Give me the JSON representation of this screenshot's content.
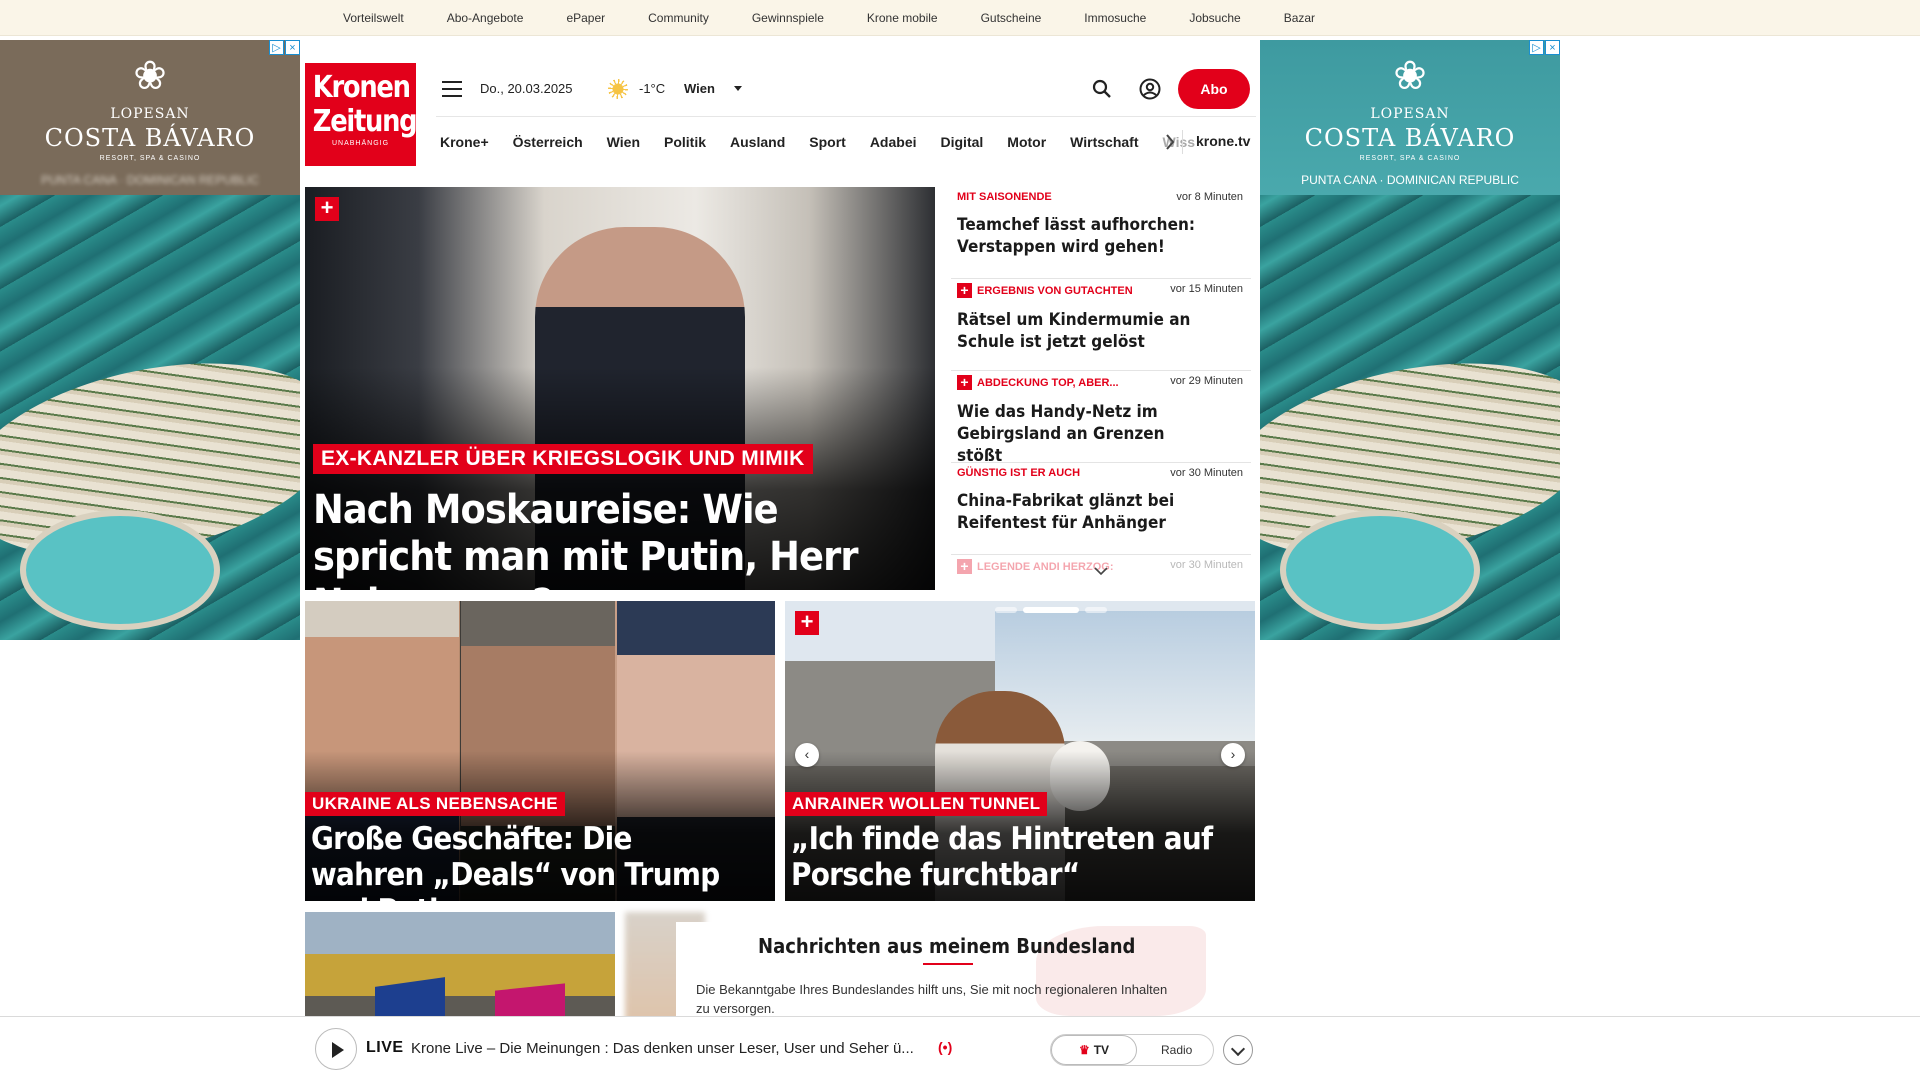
{
  "topbar": {
    "links": [
      "Vorteilswelt",
      "Abo-Angebote",
      "ePaper",
      "Community",
      "Gewinnspiele",
      "Krone mobile",
      "Gutscheine",
      "Immosuche",
      "Jobsuche",
      "Bazar"
    ]
  },
  "ads": {
    "left": {
      "brand_small": "LOPESAN",
      "brand_big": "COSTA BÁVARO",
      "tagline": "RESORT, SPA & CASINO",
      "location": "PUNTA CANA · DOMINICAN REPUBLIC"
    },
    "right": {
      "brand_small": "LOPESAN",
      "brand_big": "COSTA BÁVARO",
      "tagline": "RESORT, SPA & CASINO",
      "location": "PUNTA CANA · DOMINICAN REPUBLIC"
    },
    "choices_icons": [
      "adchoices-icon",
      "close-icon"
    ]
  },
  "header": {
    "logo_line1": "Kronen",
    "logo_line2": "Zeitung",
    "logo_tagline": "UNABHÄNGIG",
    "date": "Do., 20.03.2025",
    "weather_icon": "sun-icon",
    "temperature": "-1°C",
    "city": "Wien",
    "abo_label": "Abo"
  },
  "nav": {
    "items": [
      "Krone+",
      "Österreich",
      "Wien",
      "Politik",
      "Ausland",
      "Sport",
      "Adabei",
      "Digital",
      "Motor",
      "Wirtschaft"
    ],
    "truncated_item": "Wiss",
    "tv_label": "krone.tv"
  },
  "hero": {
    "kicker": "EX-KANZLER ÜBER KRIEGSLOGIK UND MIMIK",
    "headline": "Nach Moskaureise: Wie spricht man mit Putin, Herr Nehammer?"
  },
  "ticker": [
    {
      "kicker": "MIT SAISONENDE",
      "time": "vor 8 Minuten",
      "title": "Teamchef lässt aufhorchen: Verstappen wird gehen!",
      "plus": false
    },
    {
      "kicker": "ERGEBNIS VON GUTACHTEN",
      "time": "vor 15 Minuten",
      "title": "Rätsel um Kindermumie an Schule ist jetzt gelöst",
      "plus": true
    },
    {
      "kicker": "ABDECKUNG TOP, ABER...",
      "time": "vor 29 Minuten",
      "title": "Wie das Handy-Netz im Gebirgsland an Grenzen stößt",
      "plus": true
    },
    {
      "kicker": "GÜNSTIG IST ER AUCH",
      "time": "vor 30 Minuten",
      "title": "China-Fabrikat glänzt bei Reifentest für Anhänger",
      "plus": false
    },
    {
      "kicker": "LEGENDE ANDI HERZOG:",
      "time": "vor 30 Minuten",
      "title": "",
      "plus": true
    }
  ],
  "cards": {
    "a": {
      "kicker": "UKRAINE ALS NEBENSACHE",
      "headline": "Große Geschäfte: Die wahren „Deals“ von Trump und Putin"
    },
    "b": {
      "kicker": "ANRAINER WOLLEN TUNNEL",
      "headline": "„Ich finde das Hintreten auf Porsche furchtbar“"
    }
  },
  "bundesland": {
    "heading": "Nachrichten aus meinem Bundesland",
    "description": "Die Bekanntgabe Ihres Bundeslandes hilft uns, Sie mit noch regionaleren Inhalten zu versorgen."
  },
  "live": {
    "label": "LIVE",
    "title": "Krone Live – Die Meinungen : Das denken unser Leser, User und Seher ü...",
    "radio_icon": "(•)",
    "toggle_tv": "TV",
    "toggle_radio": "Radio"
  },
  "colors": {
    "brand_red": "#e2001a",
    "topbar_bg": "#faf5e8"
  }
}
